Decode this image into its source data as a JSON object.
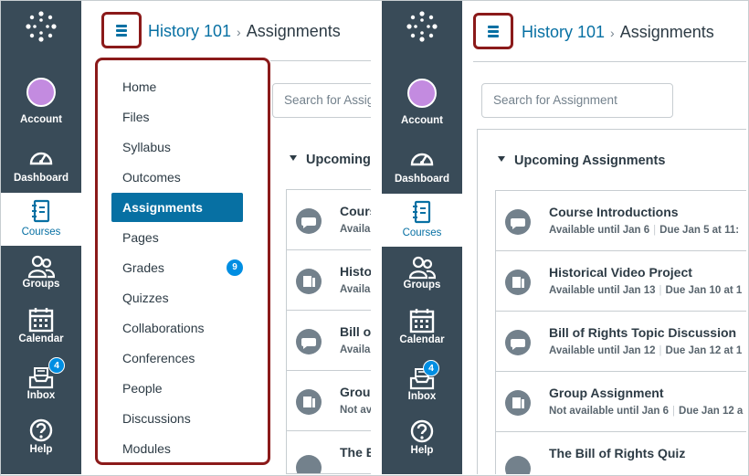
{
  "breadcrumb": {
    "course": "History 101",
    "separator": "›",
    "current": "Assignments"
  },
  "global_nav": {
    "items": [
      {
        "label": "Account",
        "icon": "avatar"
      },
      {
        "label": "Dashboard",
        "icon": "dashboard-icon"
      },
      {
        "label": "Courses",
        "icon": "courses-icon"
      },
      {
        "label": "Groups",
        "icon": "groups-icon"
      },
      {
        "label": "Calendar",
        "icon": "calendar-icon"
      },
      {
        "label": "Inbox",
        "icon": "inbox-icon",
        "badge": "4"
      },
      {
        "label": "Help",
        "icon": "help-icon"
      }
    ]
  },
  "course_nav": {
    "items": [
      "Home",
      "Files",
      "Syllabus",
      "Outcomes",
      "Assignments",
      "Pages",
      "Grades",
      "Quizzes",
      "Collaborations",
      "Conferences",
      "People",
      "Discussions",
      "Modules"
    ],
    "active": "Assignments",
    "grades_badge": "9"
  },
  "search": {
    "placeholder_left": "Search for Assig",
    "placeholder_right": "Search for Assignment"
  },
  "section": {
    "title": "Upcoming Assignments",
    "title_left_cut": "Upcoming"
  },
  "assignments": [
    {
      "title": "Course Introductions",
      "title_cut": "Cours",
      "availability": "Available until Jan 6",
      "avail_cut": "Availa",
      "due": "Due Jan 5 at 11:",
      "icon": "discussion-icon"
    },
    {
      "title": "Historical Video Project",
      "title_cut": "Histo",
      "availability": "Available until Jan 13",
      "avail_cut": "Availa",
      "due": "Due Jan 10 at 1",
      "icon": "assignment-icon"
    },
    {
      "title": "Bill of Rights Topic Discussion",
      "title_cut": "Bill o",
      "availability": "Available until Jan 12",
      "avail_cut": "Availa",
      "due": "Due Jan 12 at 1",
      "icon": "discussion-icon"
    },
    {
      "title": "Group Assignment",
      "title_cut": "Group",
      "availability": "Not available until Jan 6",
      "avail_cut": "Not av",
      "due": "Due Jan 12 a",
      "icon": "assignment-icon"
    },
    {
      "title": "The Bill of Rights Quiz",
      "title_cut": "The B",
      "availability": "",
      "avail_cut": "",
      "due": "",
      "icon": "quiz-icon"
    }
  ],
  "colors": {
    "nav_bg": "#394b58",
    "link": "#0770a3",
    "badge": "#008ee2",
    "highlight_border": "#8b1a1a"
  }
}
